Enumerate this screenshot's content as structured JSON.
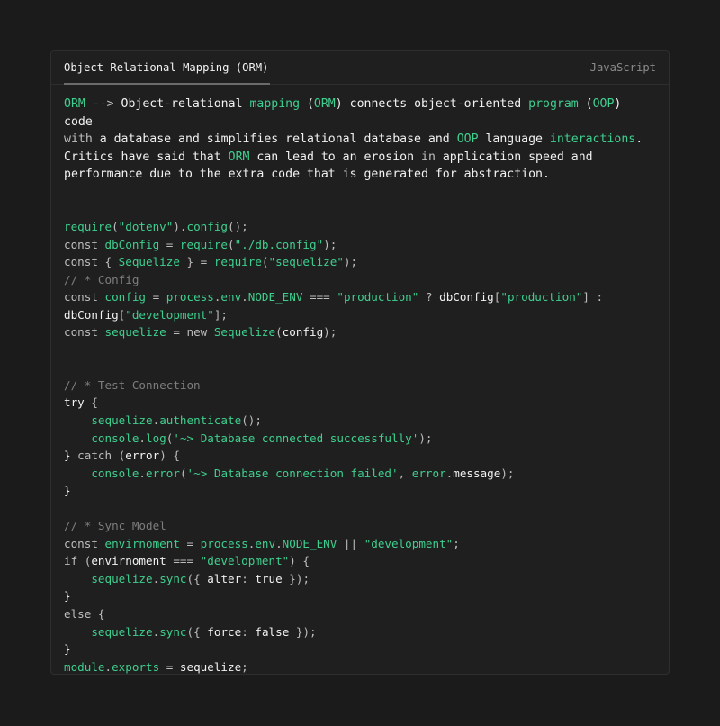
{
  "header": {
    "tab_label": "Object Relational Mapping (ORM)",
    "language": "JavaScript"
  },
  "description": [
    [
      [
        "g",
        "ORM"
      ],
      [
        "m",
        " --> "
      ],
      [
        "w",
        "Object-relational "
      ],
      [
        "g",
        "mapping"
      ],
      [
        "w",
        " ("
      ],
      [
        "g",
        "ORM"
      ],
      [
        "w",
        ") connects object-oriented "
      ],
      [
        "g",
        "program"
      ],
      [
        "w",
        " ("
      ],
      [
        "g",
        "OOP"
      ],
      [
        "w",
        ") code"
      ]
    ],
    [
      [
        "m",
        "with"
      ],
      [
        "w",
        " a database and simplifies relational database and "
      ],
      [
        "g",
        "OOP"
      ],
      [
        "w",
        " language "
      ],
      [
        "g",
        "interactions"
      ],
      [
        "w",
        "."
      ]
    ],
    [
      [
        "w",
        "Critics have said that "
      ],
      [
        "g",
        "ORM"
      ],
      [
        "w",
        " can lead to an erosion "
      ],
      [
        "m",
        "in"
      ],
      [
        "w",
        " application speed and"
      ]
    ],
    [
      [
        "w",
        "performance due to the extra code that is generated for abstraction."
      ]
    ]
  ],
  "code_lines": [
    [
      [
        "g",
        "require"
      ],
      [
        "m",
        "("
      ],
      [
        "s",
        "\"dotenv\""
      ],
      [
        "m",
        ")."
      ],
      [
        "g",
        "config"
      ],
      [
        "m",
        "();"
      ]
    ],
    [
      [
        "m",
        "const "
      ],
      [
        "g",
        "dbConfig"
      ],
      [
        "m",
        " = "
      ],
      [
        "g",
        "require"
      ],
      [
        "m",
        "("
      ],
      [
        "s",
        "\"./db.config\""
      ],
      [
        "m",
        ");"
      ]
    ],
    [
      [
        "m",
        "const { "
      ],
      [
        "g",
        "Sequelize"
      ],
      [
        "m",
        " } = "
      ],
      [
        "g",
        "require"
      ],
      [
        "m",
        "("
      ],
      [
        "s",
        "\"sequelize\""
      ],
      [
        "m",
        ");"
      ]
    ],
    [
      [
        "c",
        "// * Config"
      ]
    ],
    [
      [
        "m",
        "const "
      ],
      [
        "g",
        "config"
      ],
      [
        "m",
        " = "
      ],
      [
        "g",
        "process"
      ],
      [
        "m",
        "."
      ],
      [
        "g",
        "env"
      ],
      [
        "m",
        "."
      ],
      [
        "g",
        "NODE_ENV"
      ],
      [
        "m",
        " === "
      ],
      [
        "s",
        "\"production\""
      ],
      [
        "m",
        " ? "
      ],
      [
        "w",
        "dbConfig"
      ],
      [
        "m",
        "["
      ],
      [
        "s",
        "\"production\""
      ],
      [
        "m",
        "] :"
      ]
    ],
    [
      [
        "w",
        "dbConfig"
      ],
      [
        "m",
        "["
      ],
      [
        "s",
        "\"development\""
      ],
      [
        "m",
        "];"
      ]
    ],
    [
      [
        "m",
        "const "
      ],
      [
        "g",
        "sequelize"
      ],
      [
        "m",
        " = new "
      ],
      [
        "g",
        "Sequelize"
      ],
      [
        "m",
        "("
      ],
      [
        "w",
        "config"
      ],
      [
        "m",
        ");"
      ]
    ],
    [],
    [],
    [
      [
        "c",
        "// * Test Connection"
      ]
    ],
    [
      [
        "w",
        "try"
      ],
      [
        "m",
        " {"
      ]
    ],
    [
      [
        "m",
        "    "
      ],
      [
        "g",
        "sequelize"
      ],
      [
        "m",
        "."
      ],
      [
        "g",
        "authenticate"
      ],
      [
        "m",
        "();"
      ]
    ],
    [
      [
        "m",
        "    "
      ],
      [
        "g",
        "console"
      ],
      [
        "m",
        "."
      ],
      [
        "g",
        "log"
      ],
      [
        "m",
        "("
      ],
      [
        "s",
        "'~> Database connected successfully'"
      ],
      [
        "m",
        ");"
      ]
    ],
    [
      [
        "w",
        "}"
      ],
      [
        "m",
        " catch ("
      ],
      [
        "w",
        "error"
      ],
      [
        "m",
        ") {"
      ]
    ],
    [
      [
        "m",
        "    "
      ],
      [
        "g",
        "console"
      ],
      [
        "m",
        "."
      ],
      [
        "g",
        "error"
      ],
      [
        "m",
        "("
      ],
      [
        "s",
        "'~> Database connection failed'"
      ],
      [
        "m",
        ", "
      ],
      [
        "g",
        "error"
      ],
      [
        "m",
        "."
      ],
      [
        "w",
        "message"
      ],
      [
        "m",
        ");"
      ]
    ],
    [
      [
        "w",
        "}"
      ]
    ],
    [],
    [
      [
        "c",
        "// * Sync Model"
      ]
    ],
    [
      [
        "m",
        "const "
      ],
      [
        "g",
        "envirnoment"
      ],
      [
        "m",
        " = "
      ],
      [
        "g",
        "process"
      ],
      [
        "m",
        "."
      ],
      [
        "g",
        "env"
      ],
      [
        "m",
        "."
      ],
      [
        "g",
        "NODE_ENV"
      ],
      [
        "m",
        " || "
      ],
      [
        "s",
        "\"development\""
      ],
      [
        "m",
        ";"
      ]
    ],
    [
      [
        "m",
        "if ("
      ],
      [
        "w",
        "envirnoment"
      ],
      [
        "m",
        " === "
      ],
      [
        "s",
        "\"development\""
      ],
      [
        "m",
        ") {"
      ]
    ],
    [
      [
        "m",
        "    "
      ],
      [
        "g",
        "sequelize"
      ],
      [
        "m",
        "."
      ],
      [
        "g",
        "sync"
      ],
      [
        "m",
        "({ "
      ],
      [
        "w",
        "alter"
      ],
      [
        "m",
        ": "
      ],
      [
        "w",
        "true"
      ],
      [
        "m",
        " });"
      ]
    ],
    [
      [
        "w",
        "}"
      ]
    ],
    [
      [
        "m",
        "else {"
      ]
    ],
    [
      [
        "m",
        "    "
      ],
      [
        "g",
        "sequelize"
      ],
      [
        "m",
        "."
      ],
      [
        "g",
        "sync"
      ],
      [
        "m",
        "({ "
      ],
      [
        "w",
        "force"
      ],
      [
        "m",
        ": "
      ],
      [
        "w",
        "false"
      ],
      [
        "m",
        " });"
      ]
    ],
    [
      [
        "w",
        "}"
      ]
    ],
    [
      [
        "g",
        "module"
      ],
      [
        "m",
        "."
      ],
      [
        "g",
        "exports"
      ],
      [
        "m",
        " = "
      ],
      [
        "w",
        "sequelize"
      ],
      [
        "m",
        ";"
      ]
    ]
  ],
  "colors": {
    "background": "#1b1b1b",
    "card": "#1f1f1f",
    "accent_green": "#3ecf8e",
    "comment": "#7d7d7d"
  }
}
